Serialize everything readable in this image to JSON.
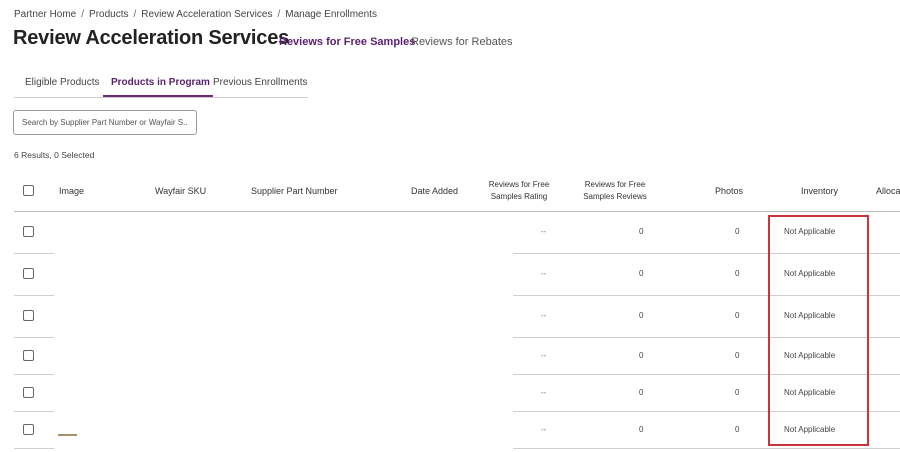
{
  "breadcrumb": [
    "Partner Home",
    "Products",
    "Review Acceleration Services",
    "Manage Enrollments"
  ],
  "page_title": "Review Acceleration Services",
  "top_tabs": [
    "Reviews for Free Samples",
    "Reviews for Rebates"
  ],
  "sub_tabs": [
    "Eligible Products",
    "Products in Program",
    "Previous Enrollments"
  ],
  "search": {
    "placeholder": "Search by Supplier Part Number or Wayfair S..."
  },
  "result_count": "6 Results,  0 Selected",
  "table": {
    "headers": [
      "Image",
      "Wayfair SKU",
      "Supplier Part Number",
      "Date Added",
      "Reviews for Free Samples Rating",
      "Reviews for Free Samples Reviews",
      "Photos",
      "Inventory",
      "Alloca"
    ],
    "rows": [
      {
        "rating": "--",
        "reviews": "0",
        "photos": "0",
        "inventory": "Not Applicable"
      },
      {
        "rating": "--",
        "reviews": "0",
        "photos": "0",
        "inventory": "Not Applicable"
      },
      {
        "rating": "--",
        "reviews": "0",
        "photos": "0",
        "inventory": "Not Applicable"
      },
      {
        "rating": "--",
        "reviews": "0",
        "photos": "0",
        "inventory": "Not Applicable"
      },
      {
        "rating": "--",
        "reviews": "0",
        "photos": "0",
        "inventory": "Not Applicable"
      },
      {
        "rating": "--",
        "reviews": "0",
        "photos": "0",
        "inventory": "Not Applicable"
      }
    ]
  },
  "colors": {
    "accent": "#5a1f6e",
    "highlight": "#c8353c"
  }
}
